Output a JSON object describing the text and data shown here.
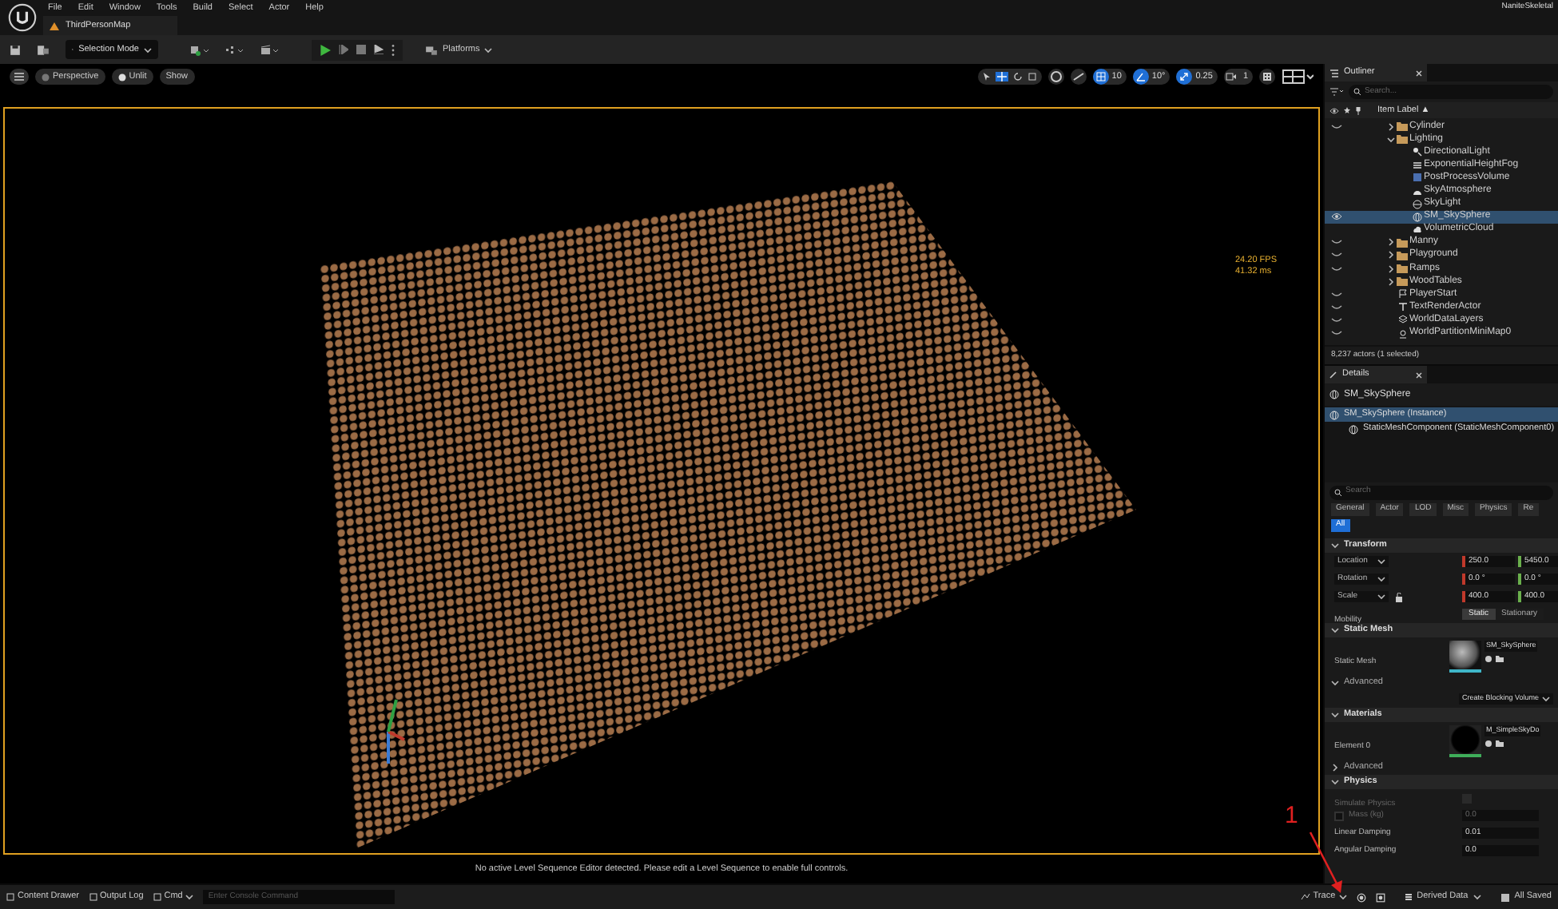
{
  "menu": [
    "File",
    "Edit",
    "Window",
    "Tools",
    "Build",
    "Select",
    "Actor",
    "Help"
  ],
  "project_name": "NaniteSkeletal",
  "document_tab": "ThirdPersonMap",
  "toolbar": {
    "mode": "Selection Mode",
    "platforms": "Platforms"
  },
  "viewport": {
    "buttons": [
      "Perspective",
      "Unlit",
      "Show"
    ],
    "snaps": [
      {
        "kind": "grid",
        "value": "10",
        "on": true
      },
      {
        "kind": "angle",
        "value": "10°",
        "on": true
      },
      {
        "kind": "scale",
        "value": "0.25",
        "on": true
      },
      {
        "kind": "camera",
        "value": "1",
        "on": false
      }
    ],
    "stats": [
      "24.20 FPS",
      "41.32 ms"
    ],
    "message": "No active Level Sequence Editor detected. Please edit a Level Sequence to enable full controls."
  },
  "outliner": {
    "title": "Outliner",
    "search_placeholder": "Search...",
    "column": "Item Label ▲",
    "items": [
      {
        "label": "Cylinder",
        "kind": "folder",
        "expanded": false,
        "visible": false,
        "selected": false
      },
      {
        "label": "Lighting",
        "kind": "folder",
        "expanded": true,
        "selected": false,
        "children": [
          {
            "label": "DirectionalLight",
            "kind": "light",
            "selected": false
          },
          {
            "label": "ExponentialHeightFog",
            "kind": "fog",
            "selected": false
          },
          {
            "label": "PostProcessVolume",
            "kind": "volume",
            "selected": false
          },
          {
            "label": "SkyAtmosphere",
            "kind": "sky",
            "selected": false
          },
          {
            "label": "SkyLight",
            "kind": "skylight",
            "selected": false
          },
          {
            "label": "SM_SkySphere",
            "kind": "mesh",
            "visible": true,
            "selected": true
          },
          {
            "label": "VolumetricCloud",
            "kind": "cloud",
            "selected": false
          }
        ]
      },
      {
        "label": "Manny",
        "kind": "folder",
        "expanded": false,
        "visible": false,
        "selected": false
      },
      {
        "label": "Playground",
        "kind": "folder",
        "expanded": false,
        "visible": false,
        "selected": false
      },
      {
        "label": "Ramps",
        "kind": "folder",
        "expanded": false,
        "visible": false,
        "selected": false
      },
      {
        "label": "WoodTables",
        "kind": "folder",
        "expanded": false,
        "selected": false
      },
      {
        "label": "PlayerStart",
        "kind": "player",
        "visible": false,
        "selected": false
      },
      {
        "label": "TextRenderActor",
        "kind": "text",
        "visible": false,
        "selected": false
      },
      {
        "label": "WorldDataLayers",
        "kind": "layers",
        "visible": false,
        "selected": false
      },
      {
        "label": "WorldPartitionMiniMap0",
        "kind": "map",
        "visible": false,
        "selected": false
      }
    ],
    "footer": "8,237 actors (1 selected)"
  },
  "details": {
    "title": "Details",
    "actor": "SM_SkySphere",
    "components": [
      {
        "label": "SM_SkySphere (Instance)",
        "selected": true,
        "children": [
          {
            "label": "StaticMeshComponent (StaticMeshComponent0)",
            "selected": false
          }
        ]
      }
    ],
    "search_placeholder": "Search",
    "filters": [
      {
        "label": "General",
        "selected": false
      },
      {
        "label": "Actor",
        "selected": false
      },
      {
        "label": "LOD",
        "selected": false
      },
      {
        "label": "Misc",
        "selected": false
      },
      {
        "label": "Physics",
        "selected": false
      },
      {
        "label": "Re",
        "selected": false
      },
      {
        "label": "All",
        "selected": true
      }
    ],
    "sections": [
      {
        "title": "Transform",
        "expanded": true,
        "sub": false,
        "rows": [
          {
            "kind": "vector",
            "label": "Location",
            "values": [
              "250.0",
              "5450.0"
            ]
          },
          {
            "kind": "vector",
            "label": "Rotation",
            "values": [
              "0.0 °",
              "0.0 °"
            ]
          },
          {
            "kind": "vector",
            "label": "Scale",
            "values": [
              "400.0",
              "400.0"
            ],
            "locked": false
          },
          {
            "kind": "toggle",
            "label": "Mobility",
            "options": [
              {
                "label": "Static",
                "selected": true
              },
              {
                "label": "Stationary",
                "selected": false
              }
            ]
          }
        ]
      },
      {
        "title": "Static Mesh",
        "expanded": true,
        "sub": false,
        "rows": [
          {
            "kind": "mesh_asset",
            "label": "Static Mesh",
            "value": "SM_SkySphere"
          }
        ]
      },
      {
        "title": "Advanced",
        "expanded": true,
        "sub": true,
        "rows": [
          {
            "kind": "dropdown",
            "value": "Create Blocking Volume"
          }
        ]
      },
      {
        "title": "Materials",
        "expanded": true,
        "sub": false,
        "rows": [
          {
            "kind": "material_asset",
            "label": "Element 0",
            "value": "M_SimpleSkyDo"
          }
        ]
      },
      {
        "title": "Advanced",
        "expanded": false,
        "sub": true
      },
      {
        "title": "Physics",
        "expanded": true,
        "sub": false,
        "rows": [
          {
            "kind": "check",
            "label": "Simulate Physics",
            "checked": false,
            "disabled": true
          },
          {
            "kind": "number",
            "label": "Mass (kg)",
            "value": "0.0",
            "disabled": true,
            "checkbox": true
          },
          {
            "kind": "number",
            "label": "Linear Damping",
            "value": "0.01",
            "disabled": false
          },
          {
            "kind": "number",
            "label": "Angular Damping",
            "value": "0.0",
            "disabled": false
          }
        ]
      }
    ]
  },
  "status_bar": {
    "left": [
      {
        "kind": "drawer",
        "label": "Content Drawer"
      },
      {
        "kind": "log",
        "label": "Output Log"
      },
      {
        "kind": "cmd",
        "label": "Cmd"
      }
    ],
    "console_placeholder": "Enter Console Command",
    "trace": "Trace",
    "derived": "Derived Data",
    "saved": "All Saved"
  },
  "annotation": "1"
}
